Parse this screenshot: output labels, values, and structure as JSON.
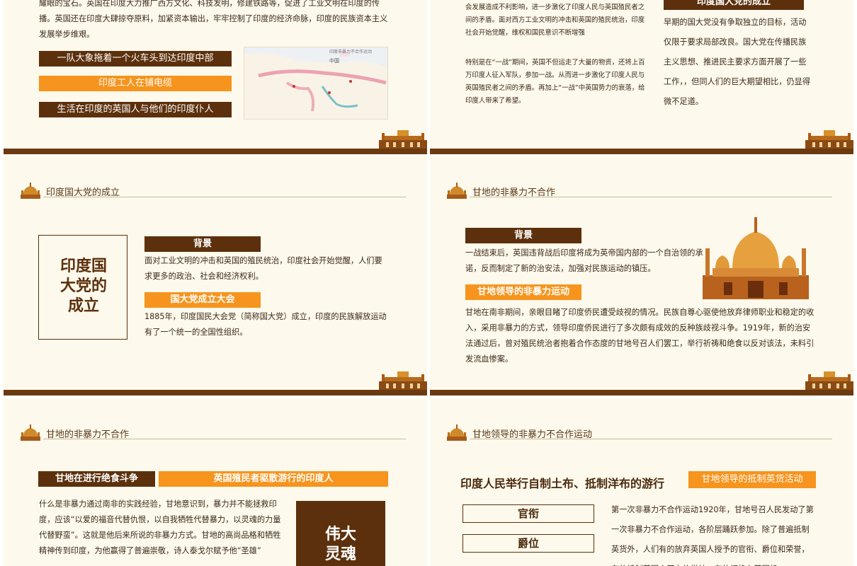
{
  "slide1": {
    "text": "耀眼的宝石。英国在印度大力推广西方文化、科技发明，修建铁路等，促进了工业文明在印度的传播。英国还在印度大肆掠夺原料，加紧资本输出，牢牢控制了印度的经济命脉，印度的民族资本主义发展举步维艰。",
    "tags": [
      "一队大象拖着一个火车头到达印度中部",
      "印度工人在铺电缆",
      "生活在印度的英国人与他们的印度仆人"
    ],
    "map_caption": "印度非暴力不合作运动",
    "map_label": "中国"
  },
  "slide2": {
    "text_top": "会发展造成不利影响，进一步激化了印度人民与英国殖民者之间的矛盾。面对西方工业文明的冲击和英国的殖民统治，印度社会开始觉醒，维权和国民意识不断增强",
    "text_bottom": "特别是在“一战”期间，英国不但运走了大量的物资，还将上百万印度人征入军队，参加一战。从而进一步激化了印度人民与英国殖民者之间的矛盾。再加上“一战”中英国势力的衰落，给印度人带来了希望。",
    "tag": "印度国大党的成立",
    "right_text": "早期的国大党没有争取独立的目标，活动仅限于要求局部改良。国大党在传播民族主义思想、推进民主要求方面开展了一些工作，，但同人们的巨大期望相比，仍显得微不足道。"
  },
  "slide3": {
    "header": "印度国大党的成立",
    "box_title": "印度国大党的成立",
    "tag1": "背景",
    "text1": "面对工业文明的冲击和英国的殖民统治，印度社会开始觉醒，人们要求更多的政治、社会和经济权利。",
    "tag2": "国大党成立大会",
    "text2": "1885年，印度国民大会党（简称国大党）成立，印度的民族解放运动有了一个统一的全国性组织。"
  },
  "slide4": {
    "header": "甘地的非暴力不合作",
    "tag1": "背景",
    "text1": "一战结束后，英国违背战后印度将成为英帝国内部的一个自治领的承诺，反而制定了新的治安法，加强对民族运动的镇压。",
    "tag2": "甘地领导的非暴力运动",
    "text2": "甘地在南非期间，亲眼目睹了印度侨民遭受歧视的情况。民族自尊心驱使他放弃律师职业和稳定的收入，采用非暴力的方式，领导印度侨民进行了多次颇有成效的反种族歧视斗争。1919年，新的治安法通过后，曾对殖民统治者抱着合作态度的甘地号召人们罢工，举行祈祷和绝食以反对该法，未料引发流血惨案。"
  },
  "slide5": {
    "header": "甘地的非暴力不合作",
    "tag1": "甘地在进行绝食斗争",
    "tag2": "英国殖民者驱散游行的印度人",
    "text": "什么是非暴力通过南非的实践经验，甘地意识到，暴力并不能拯救印度，应该“以爱的福音代替仇恨，以自我牺牲代替暴力，以灵魂的力量代替野蛮”。这就是他后来所说的非暴力方式。甘地的高尚品格和牺牲精神传到印度，为他赢得了普遍崇敬，诗人泰戈尔赋予他“圣雄”",
    "box_title": "伟大灵魂"
  },
  "slide6": {
    "header": "甘地领导的非暴力不合作运动",
    "headline": "印度人民举行自制土布、抵制洋布的游行",
    "tag": "甘地领导的抵制英货活动",
    "box1": "官衔",
    "box2": "爵位",
    "text": "第一次非暴力不合作运动1920年，甘地号召人民发动了第一次非暴力不合作运动，各阶层踊跃参加。除了普遍抵制英货外，人们有的放弃英国人授予的官衔、爵位和荣誉，有的抵制英国人开办的学校，有的拒绝在英国机"
  }
}
